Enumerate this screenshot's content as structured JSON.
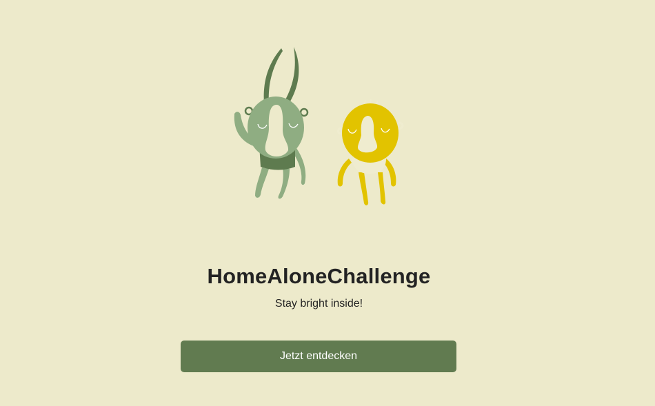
{
  "hero": {
    "title": "HomeAloneChallenge",
    "subtitle": "Stay bright inside!"
  },
  "cta": {
    "label": "Jetzt entdecken"
  },
  "illustration": {
    "characters": [
      "green-antenna-character",
      "yellow-lightbulb-character"
    ]
  },
  "colors": {
    "background": "#edeacb",
    "button": "#617b50",
    "green_light": "#8fad82",
    "green_dark": "#5e7b4f",
    "yellow": "#e2c300",
    "text": "#232323"
  }
}
